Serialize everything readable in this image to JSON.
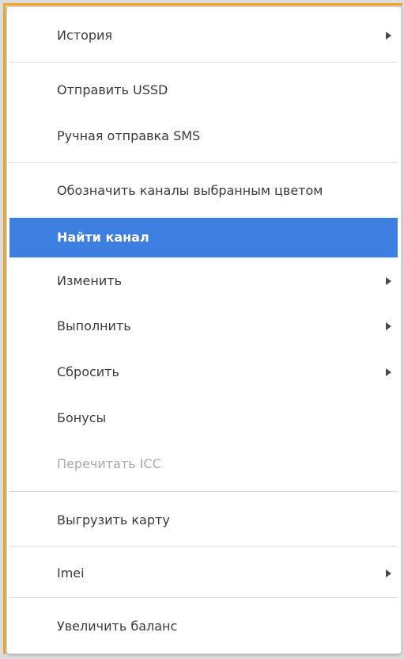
{
  "menu": {
    "items": [
      {
        "label": "История",
        "has_submenu": true,
        "state": "normal"
      },
      {
        "label": "Отправить USSD",
        "has_submenu": false,
        "state": "normal"
      },
      {
        "label": "Ручная отправка SMS",
        "has_submenu": false,
        "state": "normal"
      },
      {
        "label": "Обозначить каналы выбранным цветом",
        "has_submenu": false,
        "state": "normal"
      },
      {
        "label": "Найти канал",
        "has_submenu": false,
        "state": "highlighted"
      },
      {
        "label": "Изменить",
        "has_submenu": true,
        "state": "normal"
      },
      {
        "label": "Выполнить",
        "has_submenu": true,
        "state": "normal"
      },
      {
        "label": "Сбросить",
        "has_submenu": true,
        "state": "normal"
      },
      {
        "label": "Бонусы",
        "has_submenu": false,
        "state": "normal"
      },
      {
        "label": "Перечитать ICC",
        "has_submenu": false,
        "state": "disabled"
      },
      {
        "label": "Выгрузить карту",
        "has_submenu": false,
        "state": "normal"
      },
      {
        "label": "Imei",
        "has_submenu": true,
        "state": "normal"
      },
      {
        "label": "Увеличить баланс",
        "has_submenu": false,
        "state": "normal"
      }
    ]
  },
  "colors": {
    "highlight": "#3d7fe0",
    "accent_border": "#f2a51f",
    "disabled_text": "#a9a9a9",
    "text": "#3b3b3b"
  },
  "icons": {
    "submenu": "chevron-right-icon"
  }
}
